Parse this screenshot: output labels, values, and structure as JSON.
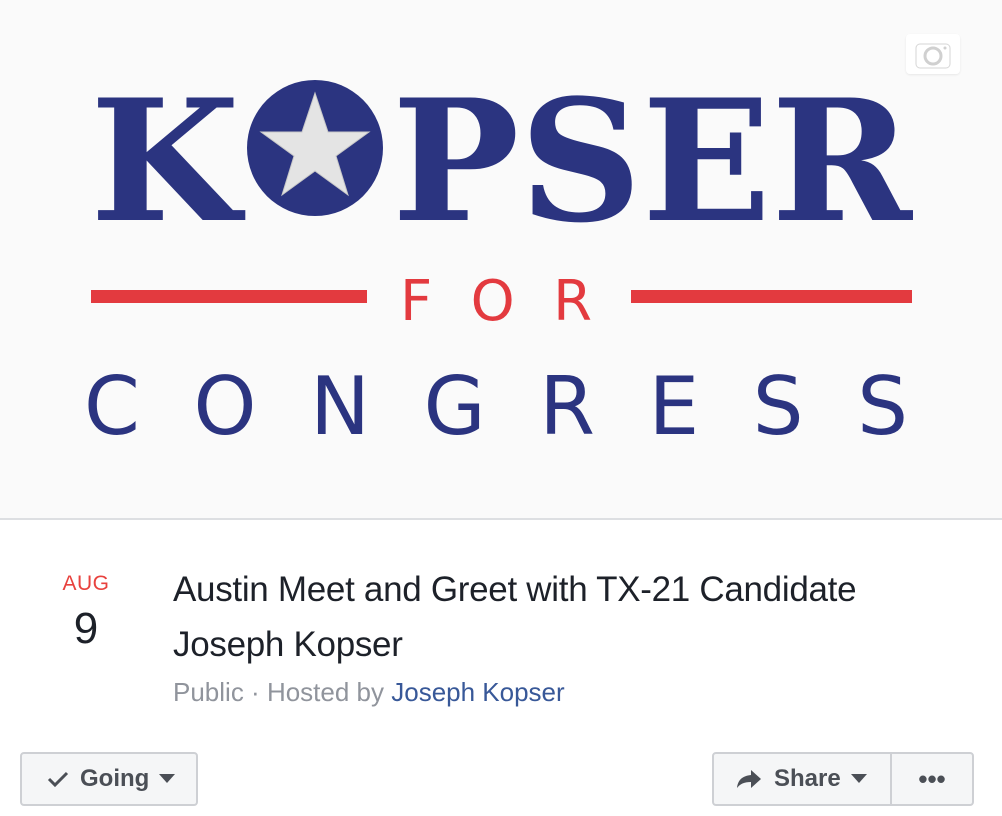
{
  "cover": {
    "logo_line1_part1": "K",
    "logo_line1_part2": "PSER",
    "logo_line2": "FOR",
    "logo_line3": "CONGRESS",
    "colors": {
      "navy": "#2b3480",
      "red": "#e33a3f",
      "star": "#dcdcdc"
    },
    "camera_icon": "camera-icon"
  },
  "event": {
    "month": "AUG",
    "day": "9",
    "title": "Austin Meet and Greet with TX-21 Candidate Joseph Kopser",
    "privacy": "Public",
    "separator": " · ",
    "hosted_by_label": "Hosted by ",
    "host_name": "Joseph Kopser"
  },
  "actions": {
    "going_label": "Going",
    "going_icons": [
      "checkmark-icon",
      "caret-down-icon"
    ],
    "share_label": "Share",
    "share_icons": [
      "share-arrow-icon",
      "caret-down-icon"
    ],
    "more_label": "•••"
  },
  "colors": {
    "date_month": "#e8423e",
    "text_primary": "#1d2129",
    "text_secondary": "#90949c",
    "link": "#385898",
    "button_bg": "#f5f6f7",
    "button_border": "#ced0d4"
  }
}
